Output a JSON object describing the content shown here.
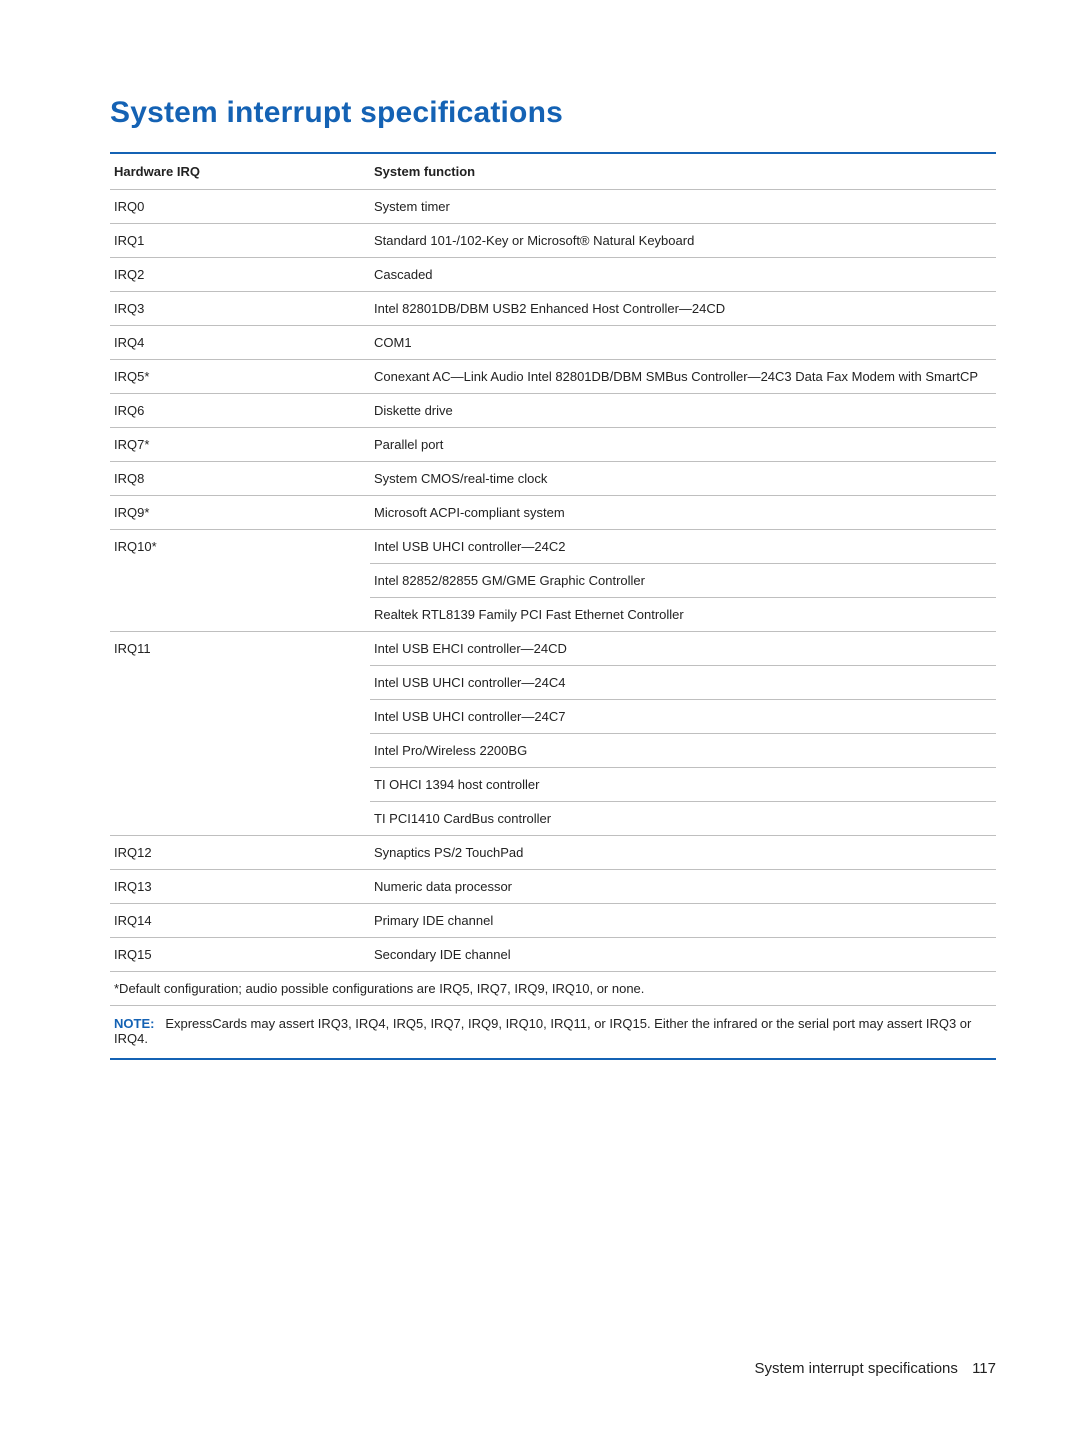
{
  "heading": "System interrupt specifications",
  "columns": {
    "irq": "Hardware IRQ",
    "func": "System function"
  },
  "rows": [
    {
      "irq": "IRQ0",
      "func": "System timer"
    },
    {
      "irq": "IRQ1",
      "func": "Standard 101-/102-Key or Microsoft® Natural Keyboard"
    },
    {
      "irq": "IRQ2",
      "func": "Cascaded"
    },
    {
      "irq": "IRQ3",
      "func": "Intel 82801DB/DBM USB2 Enhanced Host Controller—24CD"
    },
    {
      "irq": "IRQ4",
      "func": "COM1"
    },
    {
      "irq": "IRQ5*",
      "func": "Conexant AC—Link Audio Intel 82801DB/DBM SMBus Controller—24C3 Data Fax Modem with SmartCP"
    },
    {
      "irq": "IRQ6",
      "func": "Diskette drive"
    },
    {
      "irq": "IRQ7*",
      "func": "Parallel port"
    },
    {
      "irq": "IRQ8",
      "func": "System CMOS/real-time clock"
    },
    {
      "irq": "IRQ9*",
      "func": "Microsoft ACPI-compliant system"
    }
  ],
  "group10": {
    "irq": "IRQ10*",
    "lines": [
      "Intel USB UHCI controller—24C2",
      "Intel 82852/82855 GM/GME Graphic Controller",
      "Realtek RTL8139 Family PCI Fast Ethernet Controller"
    ]
  },
  "group11": {
    "irq": "IRQ11",
    "lines": [
      "Intel USB EHCI controller—24CD",
      "Intel USB UHCI controller—24C4",
      "Intel USB UHCI controller—24C7",
      "Intel Pro/Wireless 2200BG",
      "TI OHCI 1394 host controller",
      "TI PCI1410 CardBus controller"
    ]
  },
  "rows_tail": [
    {
      "irq": "IRQ12",
      "func": "Synaptics PS/2 TouchPad"
    },
    {
      "irq": "IRQ13",
      "func": "Numeric data processor"
    },
    {
      "irq": "IRQ14",
      "func": "Primary IDE channel"
    },
    {
      "irq": "IRQ15",
      "func": "Secondary IDE channel"
    }
  ],
  "footnote": "*Default configuration; audio possible configurations are IRQ5, IRQ7, IRQ9, IRQ10, or none.",
  "note_label": "NOTE:",
  "note_text": "ExpressCards may assert IRQ3, IRQ4, IRQ5, IRQ7, IRQ9, IRQ10, IRQ11, or IRQ15. Either the infrared or the serial port may assert IRQ3 or IRQ4.",
  "footer_title": "System interrupt specifications",
  "page_number": "117"
}
